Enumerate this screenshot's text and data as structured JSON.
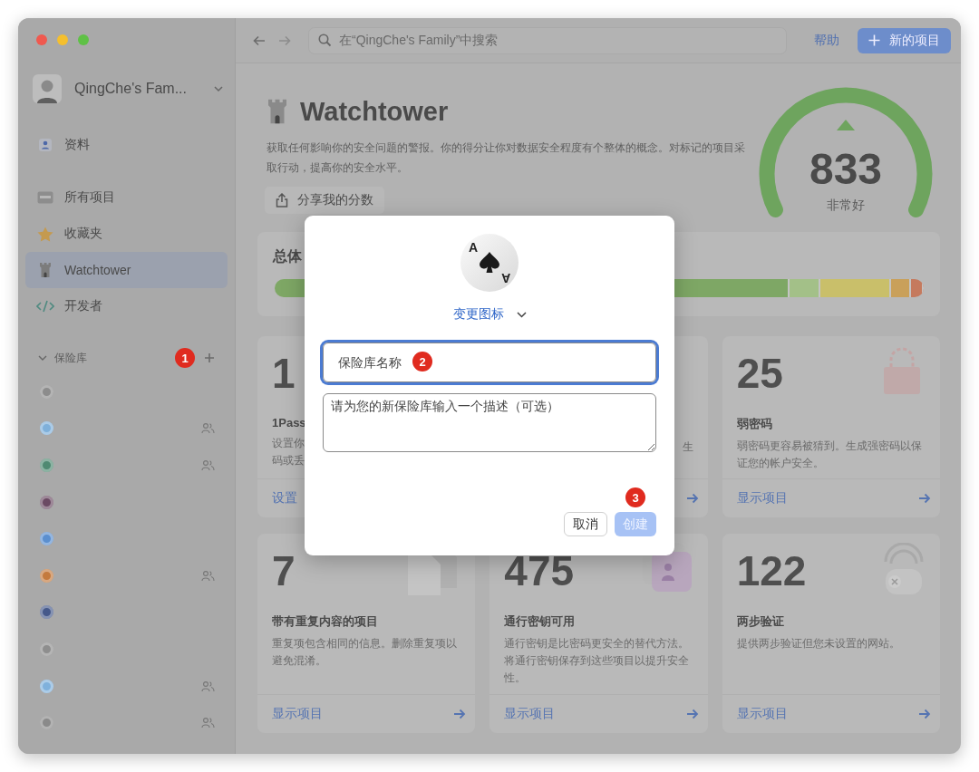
{
  "account": {
    "name": "QingChe's Fam..."
  },
  "sidebar": {
    "items": [
      {
        "label": "资料",
        "selected": false
      },
      {
        "label": "所有项目",
        "selected": false
      },
      {
        "label": "收藏夹",
        "selected": false
      },
      {
        "label": "Watchtower",
        "selected": true
      },
      {
        "label": "开发者",
        "selected": false
      }
    ],
    "vaults_header": {
      "label": "保险库",
      "expanded": true,
      "badge": "1"
    },
    "vaults": [
      {
        "color": "#8c8c8c",
        "shared": false
      },
      {
        "color": "#7fb0da",
        "shared": true
      },
      {
        "color": "#4f8a72",
        "shared": true
      },
      {
        "color": "#6b4a63",
        "shared": false
      },
      {
        "color": "#5b8fcf",
        "shared": false
      },
      {
        "color": "#c47a3e",
        "shared": true
      },
      {
        "color": "#46598a",
        "shared": false
      },
      {
        "color": "#8e8e8e",
        "shared": false
      },
      {
        "color": "#80b1dc",
        "shared": true
      },
      {
        "color": "#8a8a8a",
        "shared": true
      }
    ]
  },
  "toolbar": {
    "search_placeholder": "在“QingChe's Family”中搜索",
    "help": "帮助",
    "new_item": "新的项目"
  },
  "watchtower": {
    "title": "Watchtower",
    "description": "获取任何影响你的安全问题的警报。你的得分让你对数据安全程度有个整体的概念。对标记的项目采取行动，提高你的安全水平。",
    "share": "分享我的分数",
    "score": "833",
    "rating": "非常好"
  },
  "overall": {
    "title": "总体"
  },
  "cards": [
    {
      "kind": "left_part",
      "count": "1",
      "title": "1Pass",
      "description_lines": [
        "设置你",
        "码或丢"
      ],
      "action": "设置"
    },
    {
      "kind": "right_part",
      "description_lines": [
        "生"
      ]
    },
    {
      "kind": "full",
      "count": "25",
      "title": "弱密码",
      "description_lines": [
        "弱密码更容易被猜到。生成强密码以保证您的帐户安全。"
      ],
      "action": "显示项目"
    },
    {
      "kind": "full",
      "count": "7",
      "title": "带有重复内容的项目",
      "description_lines": [
        "重复项包含相同的信息。删除重复项以避免混淆。"
      ],
      "action": "显示项目"
    },
    {
      "kind": "full",
      "count": "475",
      "title": "通行密钥可用",
      "description_lines": [
        "通行密钥是比密码更安全的替代方法。将通行密钥保存到这些项目以提升安全性。"
      ],
      "action": "显示项目"
    },
    {
      "kind": "full",
      "count": "122",
      "title": "两步验证",
      "description_lines": [
        "提供两步验证但您未设置的网站。"
      ],
      "action": "显示项目"
    }
  ],
  "dialog": {
    "icon_corners": [
      "A",
      "A"
    ],
    "change_icon": "变更图标",
    "name_placeholder": "保险库名称",
    "name_focused": true,
    "name_badge": "2",
    "description_placeholder": "请为您的新保险库输入一个描述（可选）",
    "cancel": "取消",
    "create": "创建",
    "create_disabled": true,
    "create_badge": "3"
  }
}
